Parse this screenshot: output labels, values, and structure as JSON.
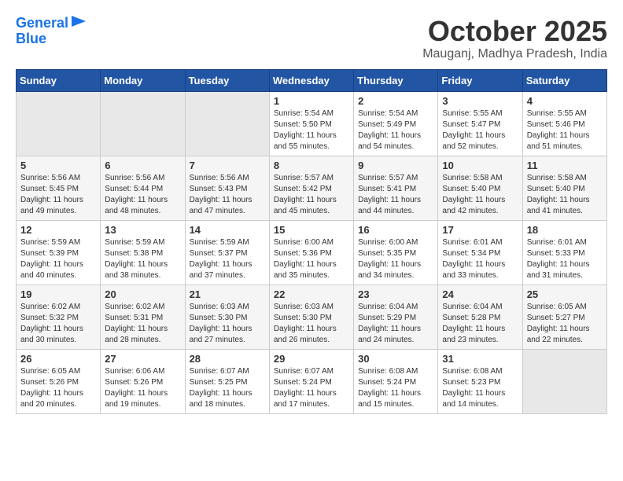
{
  "logo": {
    "line1": "General",
    "line2": "Blue"
  },
  "title": "October 2025",
  "location": "Mauganj, Madhya Pradesh, India",
  "weekdays": [
    "Sunday",
    "Monday",
    "Tuesday",
    "Wednesday",
    "Thursday",
    "Friday",
    "Saturday"
  ],
  "weeks": [
    [
      {
        "day": "",
        "info": ""
      },
      {
        "day": "",
        "info": ""
      },
      {
        "day": "",
        "info": ""
      },
      {
        "day": "1",
        "info": "Sunrise: 5:54 AM\nSunset: 5:50 PM\nDaylight: 11 hours\nand 55 minutes."
      },
      {
        "day": "2",
        "info": "Sunrise: 5:54 AM\nSunset: 5:49 PM\nDaylight: 11 hours\nand 54 minutes."
      },
      {
        "day": "3",
        "info": "Sunrise: 5:55 AM\nSunset: 5:47 PM\nDaylight: 11 hours\nand 52 minutes."
      },
      {
        "day": "4",
        "info": "Sunrise: 5:55 AM\nSunset: 5:46 PM\nDaylight: 11 hours\nand 51 minutes."
      }
    ],
    [
      {
        "day": "5",
        "info": "Sunrise: 5:56 AM\nSunset: 5:45 PM\nDaylight: 11 hours\nand 49 minutes."
      },
      {
        "day": "6",
        "info": "Sunrise: 5:56 AM\nSunset: 5:44 PM\nDaylight: 11 hours\nand 48 minutes."
      },
      {
        "day": "7",
        "info": "Sunrise: 5:56 AM\nSunset: 5:43 PM\nDaylight: 11 hours\nand 47 minutes."
      },
      {
        "day": "8",
        "info": "Sunrise: 5:57 AM\nSunset: 5:42 PM\nDaylight: 11 hours\nand 45 minutes."
      },
      {
        "day": "9",
        "info": "Sunrise: 5:57 AM\nSunset: 5:41 PM\nDaylight: 11 hours\nand 44 minutes."
      },
      {
        "day": "10",
        "info": "Sunrise: 5:58 AM\nSunset: 5:40 PM\nDaylight: 11 hours\nand 42 minutes."
      },
      {
        "day": "11",
        "info": "Sunrise: 5:58 AM\nSunset: 5:40 PM\nDaylight: 11 hours\nand 41 minutes."
      }
    ],
    [
      {
        "day": "12",
        "info": "Sunrise: 5:59 AM\nSunset: 5:39 PM\nDaylight: 11 hours\nand 40 minutes."
      },
      {
        "day": "13",
        "info": "Sunrise: 5:59 AM\nSunset: 5:38 PM\nDaylight: 11 hours\nand 38 minutes."
      },
      {
        "day": "14",
        "info": "Sunrise: 5:59 AM\nSunset: 5:37 PM\nDaylight: 11 hours\nand 37 minutes."
      },
      {
        "day": "15",
        "info": "Sunrise: 6:00 AM\nSunset: 5:36 PM\nDaylight: 11 hours\nand 35 minutes."
      },
      {
        "day": "16",
        "info": "Sunrise: 6:00 AM\nSunset: 5:35 PM\nDaylight: 11 hours\nand 34 minutes."
      },
      {
        "day": "17",
        "info": "Sunrise: 6:01 AM\nSunset: 5:34 PM\nDaylight: 11 hours\nand 33 minutes."
      },
      {
        "day": "18",
        "info": "Sunrise: 6:01 AM\nSunset: 5:33 PM\nDaylight: 11 hours\nand 31 minutes."
      }
    ],
    [
      {
        "day": "19",
        "info": "Sunrise: 6:02 AM\nSunset: 5:32 PM\nDaylight: 11 hours\nand 30 minutes."
      },
      {
        "day": "20",
        "info": "Sunrise: 6:02 AM\nSunset: 5:31 PM\nDaylight: 11 hours\nand 28 minutes."
      },
      {
        "day": "21",
        "info": "Sunrise: 6:03 AM\nSunset: 5:30 PM\nDaylight: 11 hours\nand 27 minutes."
      },
      {
        "day": "22",
        "info": "Sunrise: 6:03 AM\nSunset: 5:30 PM\nDaylight: 11 hours\nand 26 minutes."
      },
      {
        "day": "23",
        "info": "Sunrise: 6:04 AM\nSunset: 5:29 PM\nDaylight: 11 hours\nand 24 minutes."
      },
      {
        "day": "24",
        "info": "Sunrise: 6:04 AM\nSunset: 5:28 PM\nDaylight: 11 hours\nand 23 minutes."
      },
      {
        "day": "25",
        "info": "Sunrise: 6:05 AM\nSunset: 5:27 PM\nDaylight: 11 hours\nand 22 minutes."
      }
    ],
    [
      {
        "day": "26",
        "info": "Sunrise: 6:05 AM\nSunset: 5:26 PM\nDaylight: 11 hours\nand 20 minutes."
      },
      {
        "day": "27",
        "info": "Sunrise: 6:06 AM\nSunset: 5:26 PM\nDaylight: 11 hours\nand 19 minutes."
      },
      {
        "day": "28",
        "info": "Sunrise: 6:07 AM\nSunset: 5:25 PM\nDaylight: 11 hours\nand 18 minutes."
      },
      {
        "day": "29",
        "info": "Sunrise: 6:07 AM\nSunset: 5:24 PM\nDaylight: 11 hours\nand 17 minutes."
      },
      {
        "day": "30",
        "info": "Sunrise: 6:08 AM\nSunset: 5:24 PM\nDaylight: 11 hours\nand 15 minutes."
      },
      {
        "day": "31",
        "info": "Sunrise: 6:08 AM\nSunset: 5:23 PM\nDaylight: 11 hours\nand 14 minutes."
      },
      {
        "day": "",
        "info": ""
      }
    ]
  ]
}
